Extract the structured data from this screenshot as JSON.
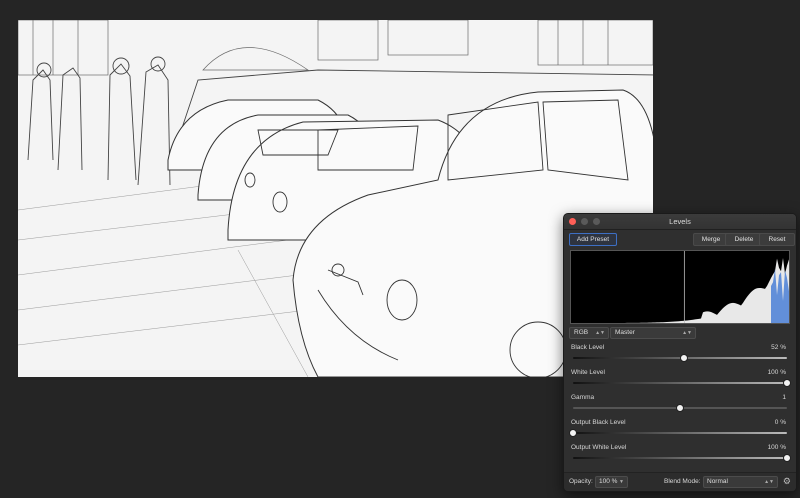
{
  "panel": {
    "title": "Levels",
    "buttons": {
      "add_preset": "Add Preset",
      "merge": "Merge",
      "delete": "Delete",
      "reset": "Reset"
    },
    "channel": "RGB",
    "mode": "Master",
    "sliders": [
      {
        "label": "Black Level",
        "value_text": "52 %",
        "level": 0.52
      },
      {
        "label": "White Level",
        "value_text": "100 %",
        "level": 1.0
      },
      {
        "label": "Gamma",
        "value_text": "1",
        "level": 0.5
      },
      {
        "label": "Output Black Level",
        "value_text": "0 %",
        "level": 0.0
      },
      {
        "label": "Output White Level",
        "value_text": "100 %",
        "level": 1.0
      }
    ],
    "footer": {
      "opacity_label": "Opacity:",
      "opacity_value": "100 %",
      "blend_label": "Blend Mode:",
      "blend_value": "Normal"
    }
  },
  "icons": {
    "close": "close-icon",
    "settings": "gear-icon",
    "stepper": "stepper-arrows-icon"
  },
  "colors": {
    "accent": "#3d6fc4",
    "close_button": "#ff5f57",
    "histogram_blue": "#4a7fd6"
  }
}
